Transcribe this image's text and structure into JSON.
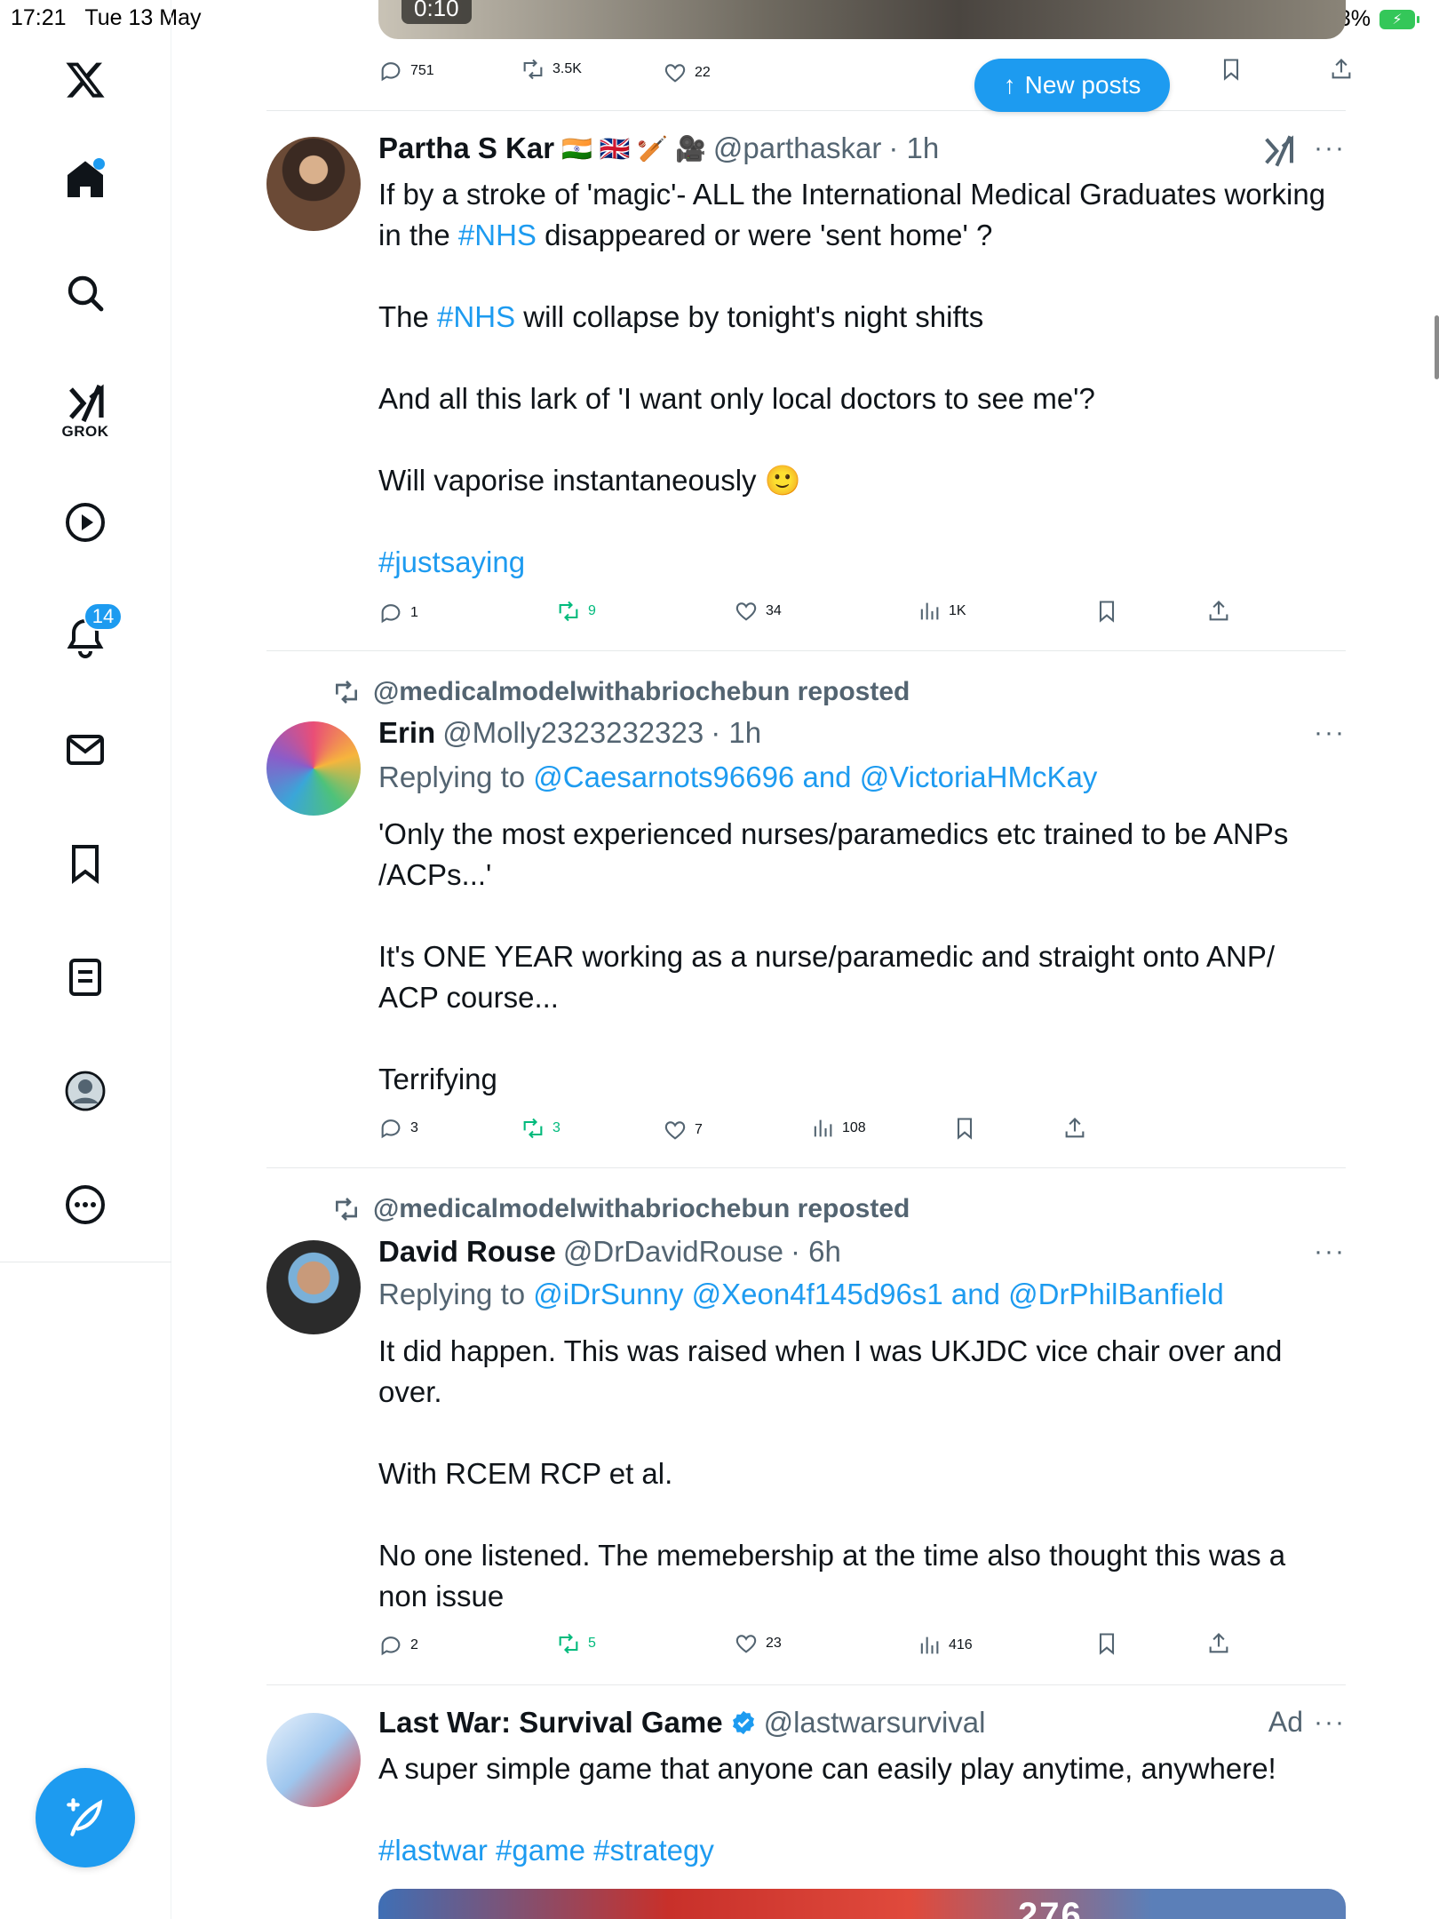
{
  "status_bar": {
    "time": "17:21",
    "date": "Tue 13 May",
    "battery": "83%"
  },
  "sidebar": {
    "items": [
      {
        "name": "home",
        "icon": "home-icon"
      },
      {
        "name": "search",
        "icon": "search-icon"
      },
      {
        "name": "grok",
        "icon": "grok-icon",
        "label": "GROK"
      },
      {
        "name": "video",
        "icon": "play-icon"
      },
      {
        "name": "notifications",
        "icon": "bell-icon",
        "badge": "14"
      },
      {
        "name": "messages",
        "icon": "mail-icon"
      },
      {
        "name": "bookmarks",
        "icon": "bookmark-icon"
      },
      {
        "name": "lists",
        "icon": "list-icon"
      },
      {
        "name": "profile",
        "icon": "avatar-icon"
      },
      {
        "name": "more",
        "icon": "more-circle-icon"
      }
    ],
    "compose_icon": "compose-feather-icon"
  },
  "feed": {
    "top_video": {
      "time": "0:10",
      "actions": {
        "replies": "751",
        "reposts": "3.5K",
        "likes": "22"
      }
    },
    "new_posts_label": "New posts",
    "tweets": [
      {
        "name": "Partha S Kar",
        "flags": "🇮🇳 🇬🇧 🏏 🎥",
        "handle": "@parthaskar",
        "time": "· 1h",
        "body": {
          "p1_a": "If by a stroke of 'magic'- ALL the International Medical Graduates working in the ",
          "p1_tag": "#NHS",
          "p1_b": " disappeared or were 'sent home' ?",
          "p2_a": "The ",
          "p2_tag": "#NHS",
          "p2_b": " will collapse by tonight's night shifts",
          "p3": "And all this lark of 'I want only local doctors to see me'?",
          "p4": "Will vaporise instantaneously 🙂",
          "p5_tag": "#justsaying"
        },
        "actions": {
          "replies": "1",
          "reposts": "9",
          "likes": "34",
          "views": "1K"
        }
      },
      {
        "repost_by": "@medicalmodelwithabriochebun reposted",
        "name": "Erin",
        "handle": "@Molly2323232323",
        "time": "· 1h",
        "reply_prefix": "Replying to ",
        "reply_to_1": "@Caesarnots96696",
        "reply_and": " and ",
        "reply_to_2": "@VictoriaHMcKay",
        "body": {
          "p1": "'Only the most experienced nurses/paramedics etc trained to be ANPs /ACPs...'",
          "p2": "It's ONE YEAR working as a nurse/paramedic and straight onto ANP/ ACP course...",
          "p3": "Terrifying"
        },
        "actions": {
          "replies": "3",
          "reposts": "3",
          "likes": "7",
          "views": "108"
        }
      },
      {
        "repost_by": "@medicalmodelwithabriochebun reposted",
        "name": "David Rouse",
        "handle": "@DrDavidRouse",
        "time": "· 6h",
        "reply_prefix": "Replying to ",
        "reply_to_1": "@iDrSunny",
        "reply_to_2": "@Xeon4f145d96s1",
        "reply_and": " and ",
        "reply_to_3": "@DrPhilBanfield",
        "body": {
          "p1": "It did happen.  This was raised when I was UKJDC vice chair over and over.",
          "p2": "With RCEM RCP et al.",
          "p3": "No one listened.  The memebership at the time also thought this was a non issue"
        },
        "actions": {
          "replies": "2",
          "reposts": "5",
          "likes": "23",
          "views": "416"
        }
      },
      {
        "name": "Last War: Survival Game",
        "handle": "@lastwarsurvival",
        "ad_label": "Ad",
        "body": {
          "p1": "A super simple game that anyone can easily play anytime, anywhere!",
          "tags": "#lastwar #game #strategy"
        },
        "image_text": "276"
      }
    ]
  },
  "colors": {
    "accent": "#1d9bf0",
    "text": "#0f1419",
    "muted": "#536471",
    "repost_green": "#00ba7c"
  }
}
